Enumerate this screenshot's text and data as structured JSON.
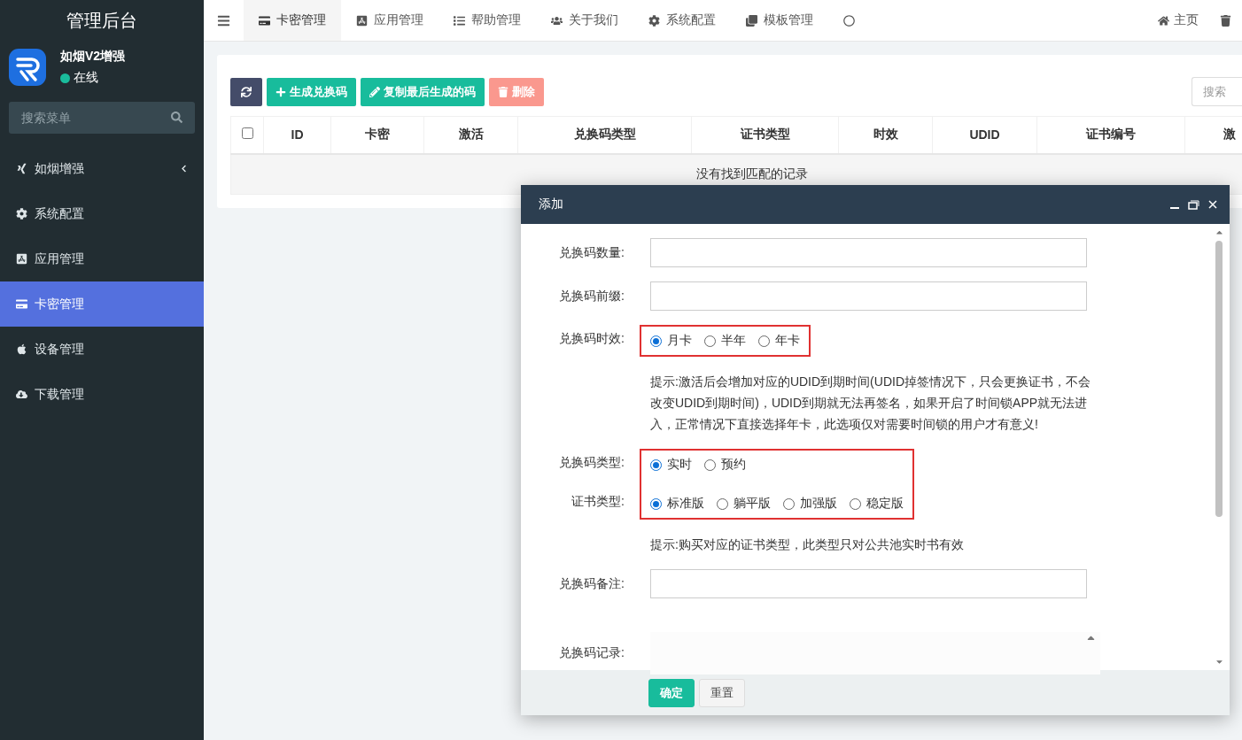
{
  "sidebar": {
    "title": "管理后台",
    "user": {
      "name": "如烟V2增强",
      "status": "在线",
      "online": true
    },
    "search": {
      "placeholder": "搜索菜单"
    },
    "items": [
      {
        "label": "如烟增强",
        "expandable": true,
        "selected": false
      },
      {
        "label": "系统配置",
        "expandable": false,
        "selected": false
      },
      {
        "label": "应用管理",
        "expandable": false,
        "selected": false
      },
      {
        "label": "卡密管理",
        "expandable": false,
        "selected": true
      },
      {
        "label": "设备管理",
        "expandable": false,
        "selected": false
      },
      {
        "label": "下载管理",
        "expandable": false,
        "selected": false
      }
    ]
  },
  "topbar": {
    "tabs": [
      {
        "label": "卡密管理",
        "selected": true
      },
      {
        "label": "应用管理",
        "selected": false
      },
      {
        "label": "帮助管理",
        "selected": false
      },
      {
        "label": "关于我们",
        "selected": false
      },
      {
        "label": "系统配置",
        "selected": false
      },
      {
        "label": "模板管理",
        "selected": false
      },
      {
        "selected": false
      }
    ],
    "links": [
      {
        "kind": "home",
        "label": "主页"
      },
      {
        "kind": "trash"
      }
    ]
  },
  "toolbar": {
    "buttons": [
      {
        "kind": "refresh",
        "disabled": false
      },
      {
        "kind": "success",
        "label": "生成兑换码",
        "disabled": false
      },
      {
        "kind": "success",
        "label": "复制最后生成的码",
        "disabled": false
      },
      {
        "kind": "danger",
        "label": "删除",
        "disabled": true
      }
    ],
    "search": {
      "placeholder": "搜索"
    }
  },
  "table": {
    "select_all_checked": false,
    "columns": [
      "ID",
      "卡密",
      "激活",
      "兑换码类型",
      "证书类型",
      "时效",
      "UDID",
      "证书编号",
      "激"
    ],
    "empty_text": "没有找到匹配的记录"
  },
  "dialog": {
    "title": "添加",
    "groups": [
      {
        "highlighted": false,
        "fields": [
          {
            "kind": "input",
            "label": "兑换码数量:"
          }
        ]
      },
      {
        "highlighted": false,
        "fields": [
          {
            "kind": "input",
            "label": "兑换码前缀:"
          }
        ]
      },
      {
        "highlighted": true,
        "fields": [
          {
            "kind": "radio",
            "label": "兑换码时效:",
            "options": [
              {
                "label": "月卡",
                "selected": true
              },
              {
                "label": "半年",
                "selected": false
              },
              {
                "label": "年卡",
                "selected": false
              }
            ]
          }
        ]
      },
      {
        "highlighted": false,
        "fields": [
          {
            "kind": "hint",
            "text": "提示:激活后会增加对应的UDID到期时间(UDID掉签情况下，只会更换证书，不会改变UDID到期时间)，UDID到期就无法再签名，如果开启了时间锁APP就无法进入，正常情况下直接选择年卡，此选项仅对需要时间锁的用户才有意义!"
          }
        ]
      },
      {
        "highlighted": true,
        "fields": [
          {
            "kind": "radio",
            "label": "兑换码类型:",
            "options": [
              {
                "label": "实时",
                "selected": true
              },
              {
                "label": "预约",
                "selected": false
              }
            ]
          },
          {
            "kind": "radio",
            "label": "证书类型:",
            "options": [
              {
                "label": "标准版",
                "selected": true
              },
              {
                "label": "躺平版",
                "selected": false
              },
              {
                "label": "加强版",
                "selected": false
              },
              {
                "label": "稳定版",
                "selected": false
              }
            ]
          }
        ]
      },
      {
        "highlighted": false,
        "fields": [
          {
            "kind": "hint",
            "text": "提示:购买对应的证书类型，此类型只对公共池实时书有效"
          }
        ]
      },
      {
        "highlighted": false,
        "fields": [
          {
            "kind": "input",
            "label": "兑换码备注:"
          }
        ]
      },
      {
        "highlighted": false,
        "fields": [
          {
            "kind": "record",
            "label": "兑换码记录:"
          }
        ]
      }
    ],
    "buttons": [
      {
        "kind": "primary",
        "label": "确定"
      },
      {
        "kind": "default",
        "label": "重置"
      }
    ]
  }
}
